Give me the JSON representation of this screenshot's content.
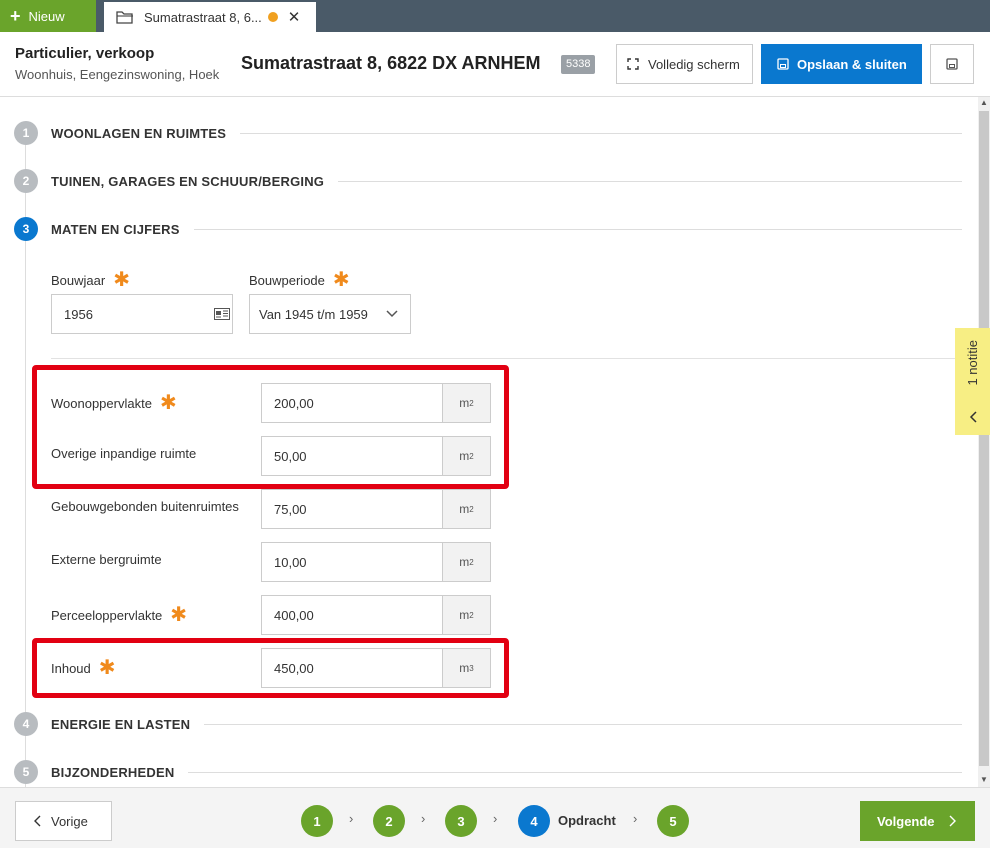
{
  "topbar": {
    "new_label": "Nieuw",
    "tab_title": "Sumatrastraat 8, 6...",
    "tab_close": "✕"
  },
  "header": {
    "type": "Particulier, verkoop",
    "subtype": "Woonhuis, Eengezinswoning, Hoek",
    "address": "Sumatrastraat 8, 6822 DX ARNHEM",
    "badge": "5338",
    "fullscreen_label": "Volledig scherm",
    "save_label": "Opslaan & sluiten"
  },
  "steps": [
    {
      "num": "1",
      "title": "WOONLAGEN EN RUIMTES"
    },
    {
      "num": "2",
      "title": "TUINEN, GARAGES EN SCHUUR/BERGING"
    },
    {
      "num": "3",
      "title": "MATEN EN CIJFERS"
    },
    {
      "num": "4",
      "title": "ENERGIE EN LASTEN"
    },
    {
      "num": "5",
      "title": "BIJZONDERHEDEN"
    }
  ],
  "form": {
    "bouwjaar": {
      "label": "Bouwjaar",
      "value": "1956"
    },
    "bouwperiode": {
      "label": "Bouwperiode",
      "value": "Van 1945 t/m 1959"
    },
    "required_mark": "✱",
    "rows": [
      {
        "label": "Woonoppervlakte",
        "value": "200,00",
        "unit": "m",
        "exp": "2"
      },
      {
        "label": "Overige inpandige ruimte",
        "value": "50,00",
        "unit": "m",
        "exp": "2"
      },
      {
        "label": "Gebouwgebonden buitenruimtes",
        "value": "75,00",
        "unit": "m",
        "exp": "2"
      },
      {
        "label": "Externe bergruimte",
        "value": "10,00",
        "unit": "m",
        "exp": "2"
      },
      {
        "label": "Perceeloppervlakte",
        "value": "400,00",
        "unit": "m",
        "exp": "2"
      },
      {
        "label": "Inhoud",
        "value": "450,00",
        "unit": "m",
        "exp": "3"
      }
    ]
  },
  "note": {
    "label": "1 notitie"
  },
  "footer": {
    "prev_label": "Vorige",
    "next_label": "Volgende",
    "pages": [
      "1",
      "2",
      "3",
      "4",
      "5"
    ],
    "active_page_label": "Opdracht"
  },
  "colors": {
    "green": "#6aa42b",
    "blue": "#0a78cf",
    "highlight": "#e20012",
    "required": "#f08a1c",
    "note": "#f7ee84"
  }
}
